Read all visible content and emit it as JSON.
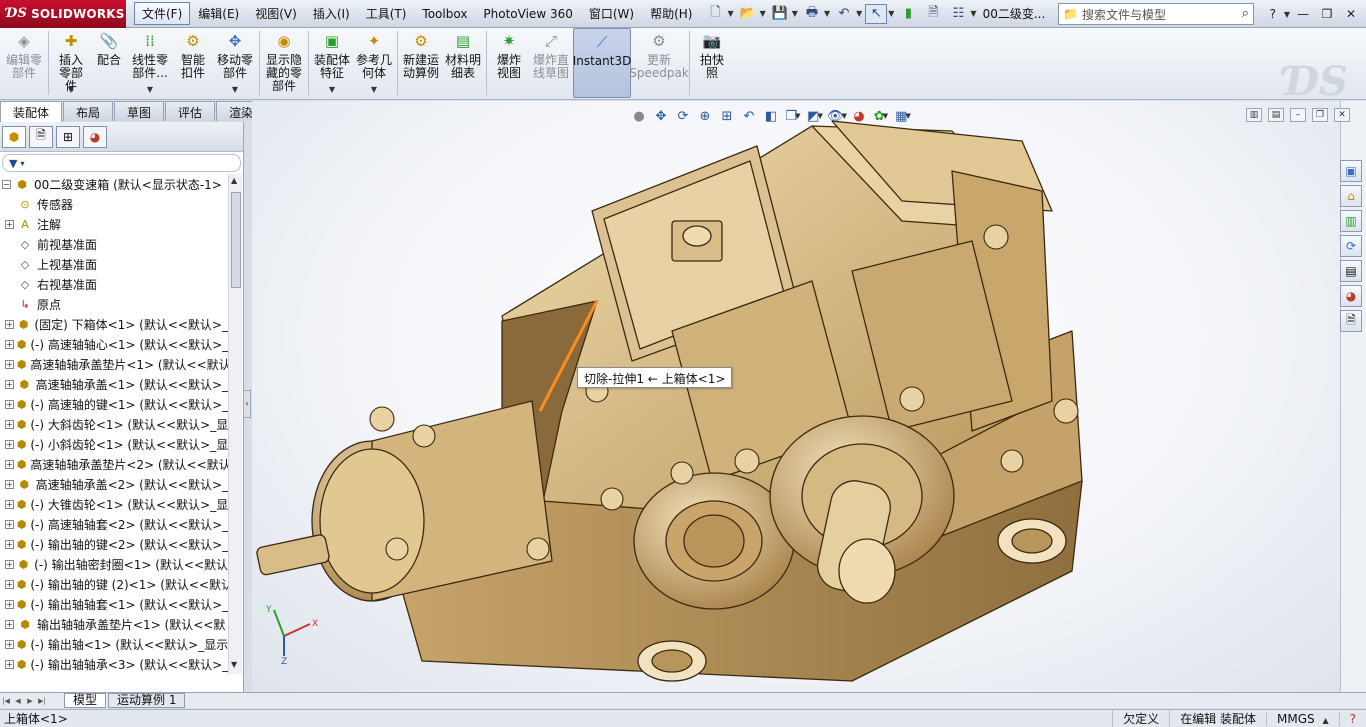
{
  "app": {
    "brand": "SOLIDWORKS",
    "doc_title": "00二级变..."
  },
  "menu": [
    {
      "label": "文件(F)",
      "active": true
    },
    {
      "label": "编辑(E)"
    },
    {
      "label": "视图(V)"
    },
    {
      "label": "插入(I)"
    },
    {
      "label": "工具(T)"
    },
    {
      "label": "Toolbox"
    },
    {
      "label": "PhotoView 360"
    },
    {
      "label": "窗口(W)"
    },
    {
      "label": "帮助(H)"
    }
  ],
  "search": {
    "placeholder": "搜索文件与模型"
  },
  "commands": [
    {
      "label": "编辑零部件",
      "icon": "edit-component-icon",
      "disabled": true
    },
    {
      "label": "插入零部件",
      "icon": "insert-component-icon",
      "dropdown": true
    },
    {
      "label": "配合",
      "icon": "mate-icon"
    },
    {
      "label": "线性零部件...",
      "icon": "linear-pattern-icon",
      "dropdown": true
    },
    {
      "label": "智能扣件",
      "icon": "smart-fastener-icon"
    },
    {
      "label": "移动零部件",
      "icon": "move-component-icon",
      "dropdown": true
    },
    {
      "label": "显示隐藏的零部件",
      "icon": "show-hidden-icon"
    },
    {
      "label": "装配体特征",
      "icon": "assembly-feature-icon",
      "dropdown": true
    },
    {
      "label": "参考几何体",
      "icon": "reference-geometry-icon",
      "dropdown": true
    },
    {
      "label": "新建运动算例",
      "icon": "motion-study-icon"
    },
    {
      "label": "材料明细表",
      "icon": "bom-icon"
    },
    {
      "label": "爆炸视图",
      "icon": "explode-view-icon"
    },
    {
      "label": "爆炸直线草图",
      "icon": "explode-line-icon",
      "disabled": true
    },
    {
      "label": "Instant3D",
      "icon": "instant3d-icon",
      "pressed": true
    },
    {
      "label": "更新Speedpak",
      "icon": "speedpak-icon",
      "disabled": true
    },
    {
      "label": "拍快照",
      "icon": "snapshot-icon"
    }
  ],
  "tabs": [
    {
      "label": "装配体",
      "active": true
    },
    {
      "label": "布局"
    },
    {
      "label": "草图"
    },
    {
      "label": "评估"
    },
    {
      "label": "渲染工具"
    }
  ],
  "tree": {
    "root": "00二级变速箱 (默认<显示状态-1>",
    "items": [
      {
        "label": "传感器",
        "type": "sensor",
        "expand": false
      },
      {
        "label": "注解",
        "type": "annotation",
        "expand": true
      },
      {
        "label": "前视基准面",
        "type": "plane",
        "expand": false
      },
      {
        "label": "上视基准面",
        "type": "plane",
        "expand": false
      },
      {
        "label": "右视基准面",
        "type": "plane",
        "expand": false
      },
      {
        "label": "原点",
        "type": "origin",
        "expand": false
      },
      {
        "label": "(固定) 下箱体<1> (默认<<默认>_",
        "type": "part",
        "expand": true
      },
      {
        "label": "(-) 高速轴轴心<1> (默认<<默认>_",
        "type": "part",
        "expand": true
      },
      {
        "label": "高速轴轴承盖垫片<1> (默认<<默认",
        "type": "part",
        "expand": true
      },
      {
        "label": "高速轴轴承盖<1> (默认<<默认>_",
        "type": "part",
        "expand": true
      },
      {
        "label": "(-) 高速轴的键<1> (默认<<默认>_",
        "type": "part",
        "expand": true
      },
      {
        "label": "(-) 大斜齿轮<1> (默认<<默认>_显",
        "type": "part",
        "expand": true
      },
      {
        "label": "(-) 小斜齿轮<1> (默认<<默认>_显",
        "type": "part",
        "expand": true
      },
      {
        "label": "高速轴轴承盖垫片<2> (默认<<默认",
        "type": "part",
        "expand": true
      },
      {
        "label": "高速轴轴承盖<2> (默认<<默认>_",
        "type": "part",
        "expand": true
      },
      {
        "label": "(-) 大锥齿轮<1> (默认<<默认>_显",
        "type": "part",
        "expand": true
      },
      {
        "label": "(-) 高速轴轴套<2> (默认<<默认>_",
        "type": "part",
        "expand": true
      },
      {
        "label": "(-) 输出轴的键<2> (默认<<默认>_",
        "type": "part",
        "expand": true
      },
      {
        "label": "(-) 输出轴密封圈<1> (默认<<默认",
        "type": "part",
        "expand": true
      },
      {
        "label": "(-) 输出轴的键 (2)<1> (默认<<默认",
        "type": "part",
        "expand": true
      },
      {
        "label": "(-) 输出轴轴套<1> (默认<<默认>_",
        "type": "part",
        "expand": true
      },
      {
        "label": "输出轴轴承盖垫片<1> (默认<<默",
        "type": "part",
        "expand": true
      },
      {
        "label": "(-) 输出轴<1> (默认<<默认>_显示",
        "type": "part",
        "expand": true
      },
      {
        "label": "(-) 输出轴轴承<3> (默认<<默认>_",
        "type": "part",
        "expand": true
      }
    ]
  },
  "sheet_tabs": [
    {
      "label": "模型",
      "active": true
    },
    {
      "label": "运动算例 1"
    }
  ],
  "status": {
    "message": "上箱体<1>",
    "cells": [
      "欠定义",
      "在编辑 装配体",
      "MMGS"
    ]
  },
  "tooltip": "切除-拉伸1 ← 上箱体<1>",
  "triad": {
    "x": "X",
    "y": "Y",
    "z": "Z"
  },
  "colors": {
    "brand_red": "#c8102e",
    "model_bronze": "#d8b880",
    "highlight_edge": "#ff8c1a"
  }
}
